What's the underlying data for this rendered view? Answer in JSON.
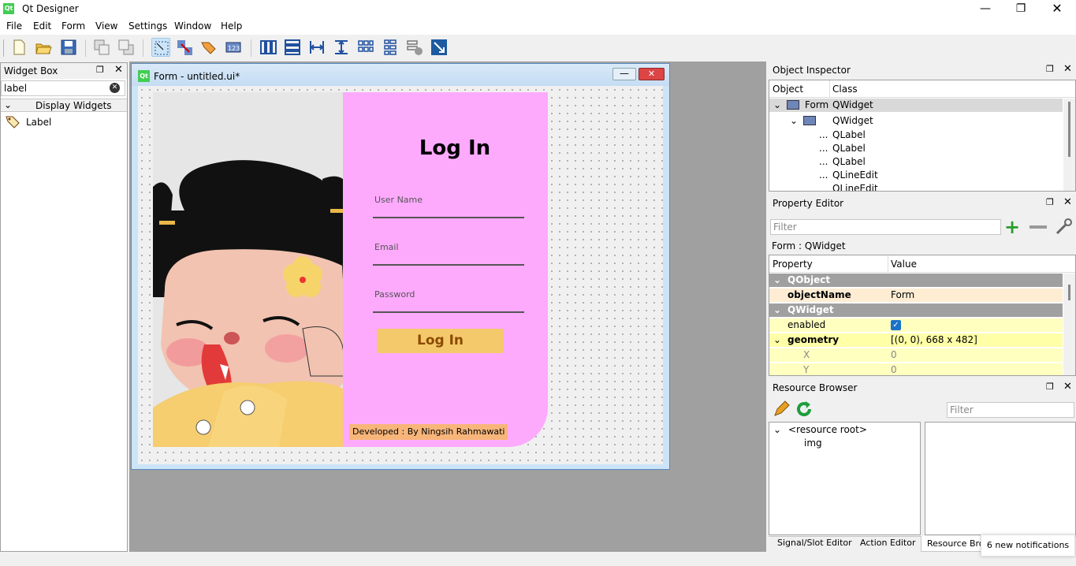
{
  "window": {
    "title": "Qt Designer",
    "icon": "Qt"
  },
  "menu": [
    "File",
    "Edit",
    "Form",
    "View",
    "Settings",
    "Window",
    "Help"
  ],
  "widget_box": {
    "title": "Widget Box",
    "search_value": "label",
    "category": "Display Widgets",
    "items": [
      "Label"
    ]
  },
  "form_window": {
    "title": "Form - untitled.ui*",
    "icon": "Qt",
    "login": {
      "heading": "Log In",
      "username_placeholder": "User Name",
      "email_placeholder": "Email",
      "password_placeholder": "Password",
      "button": "Log In",
      "footer": "Developed : By Ningsih Rahmawati"
    }
  },
  "object_inspector": {
    "title": "Object Inspector",
    "col_object": "Object",
    "col_class": "Class",
    "rows": [
      {
        "object": "Form",
        "class": "QWidget"
      },
      {
        "object": "",
        "class": "QWidget"
      },
      {
        "object": "...",
        "class": "QLabel"
      },
      {
        "object": "...",
        "class": "QLabel"
      },
      {
        "object": "...",
        "class": "QLabel"
      },
      {
        "object": "...",
        "class": "QLineEdit"
      },
      {
        "object": "",
        "class": "QLineEdit"
      }
    ]
  },
  "property_editor": {
    "title": "Property Editor",
    "filter_placeholder": "Filter",
    "context": "Form : QWidget",
    "col_property": "Property",
    "col_value": "Value",
    "group_qobject": "QObject",
    "object_name_label": "objectName",
    "object_name_value": "Form",
    "group_qwidget": "QWidget",
    "enabled_label": "enabled",
    "geometry_label": "geometry",
    "geometry_value": "[(0, 0), 668 x 482]",
    "x_label": "X",
    "x_value": "0",
    "y_label": "Y",
    "y_value": "0"
  },
  "resource_browser": {
    "title": "Resource Browser",
    "filter_placeholder": "Filter",
    "root": "<resource root>",
    "child": "img"
  },
  "bottom_tabs": [
    "Signal/Slot Editor",
    "Action Editor",
    "Resource Brow"
  ],
  "notification": "6 new notifications",
  "colors": {
    "form_bg": "#fdaafd",
    "button": "#f4c96b",
    "button_text": "#8b4a00",
    "footer_bg": "#f8b57a"
  }
}
